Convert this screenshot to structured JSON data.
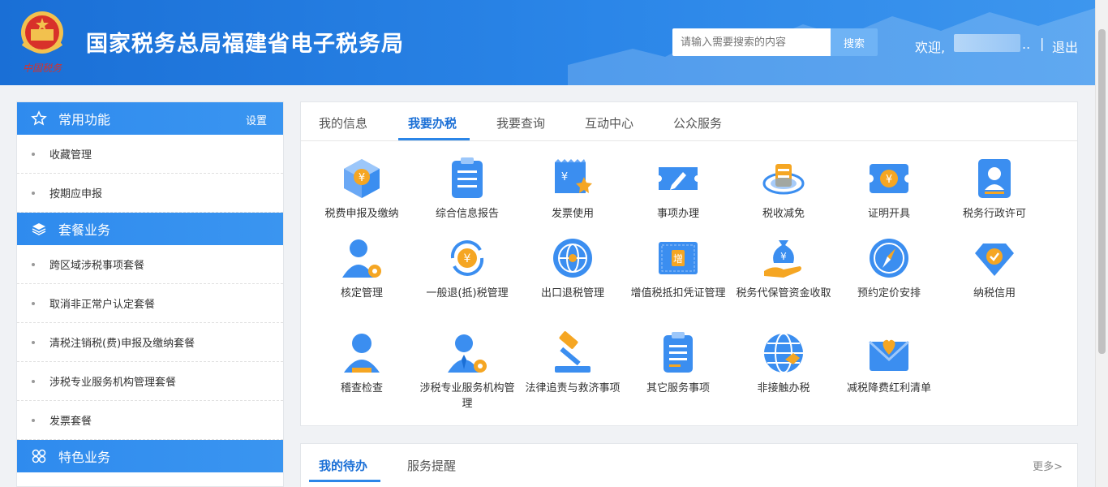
{
  "header": {
    "site_title": "国家税务总局福建省电子税务局",
    "emblem_text": "中国税务",
    "search_placeholder": "请输入需要搜索的内容",
    "search_button": "搜索",
    "welcome": "欢迎,",
    "ellipsis": "..",
    "separator": "|",
    "logout": "退出"
  },
  "sidebar": {
    "common": {
      "title": "常用功能",
      "setting": "设置",
      "items": [
        "收藏管理",
        "按期应申报"
      ]
    },
    "package": {
      "title": "套餐业务",
      "items": [
        "跨区域涉税事项套餐",
        "取消非正常户认定套餐",
        "清税注销税(费)申报及缴纳套餐",
        "涉税专业服务机构管理套餐",
        "发票套餐"
      ]
    },
    "special": {
      "title": "特色业务"
    }
  },
  "main": {
    "tabs": [
      "我的信息",
      "我要办税",
      "我要查询",
      "互动中心",
      "公众服务"
    ],
    "active_tab": "我要办税",
    "items": [
      {
        "label": "税费申报及缴纳",
        "icon": "tax-declare-cube-icon"
      },
      {
        "label": "综合信息报告",
        "icon": "clipboard-report-icon"
      },
      {
        "label": "发票使用",
        "icon": "invoice-star-icon"
      },
      {
        "label": "事项办理",
        "icon": "ticket-pen-icon"
      },
      {
        "label": "税收减免",
        "icon": "tax-relief-coins-icon"
      },
      {
        "label": "证明开具",
        "icon": "certificate-yen-icon"
      },
      {
        "label": "税务行政许可",
        "icon": "license-person-icon"
      },
      {
        "label": "核定管理",
        "icon": "user-gear-icon"
      },
      {
        "label": "一般退(抵)税管理",
        "icon": "refund-cycle-icon"
      },
      {
        "label": "出口退税管理",
        "icon": "globe-export-icon"
      },
      {
        "label": "增值税抵扣凭证管理",
        "icon": "vat-voucher-icon"
      },
      {
        "label": "税务代保管资金收取",
        "icon": "money-bag-hand-icon"
      },
      {
        "label": "预约定价安排",
        "icon": "compass-pricing-icon"
      },
      {
        "label": "纳税信用",
        "icon": "diamond-credit-icon"
      },
      {
        "label": "稽查检查",
        "icon": "inspector-user-icon"
      },
      {
        "label": "涉税专业服务机构管理",
        "icon": "agent-user-gear-icon"
      },
      {
        "label": "法律追责与救济事项",
        "icon": "gavel-icon"
      },
      {
        "label": "其它服务事项",
        "icon": "clipboard-list-icon"
      },
      {
        "label": "非接触办税",
        "icon": "globe-handshake-icon"
      },
      {
        "label": "减税降费红利清单",
        "icon": "envelope-heart-icon"
      }
    ]
  },
  "todo": {
    "tabs": [
      "我的待办",
      "服务提醒"
    ],
    "active_tab": "我的待办",
    "more": "更多>"
  },
  "colors": {
    "brand": "#1a6fd6",
    "accent": "#2b86e8",
    "icon_blue": "#3b8ef0",
    "icon_orange": "#f5a623"
  }
}
